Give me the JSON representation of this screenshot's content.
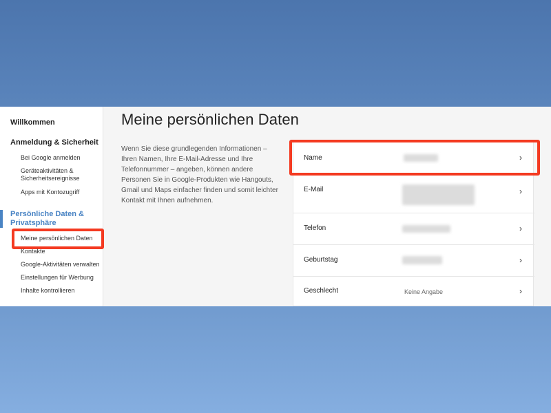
{
  "sidebar": {
    "welcome": "Willkommen",
    "security_section": "Anmeldung & Sicherheit",
    "security_items": [
      "Bei Google anmelden",
      "Geräteaktivitäten & Sicherheitsereignisse",
      "Apps mit Kontozugriff"
    ],
    "personal_section": "Persönliche Daten & Privatsphäre",
    "personal_items": [
      "Meine persönlichen Daten",
      "Kontakte",
      "Google-Aktivitäten verwalten",
      "Einstellungen für Werbung",
      "Inhalte kontrollieren"
    ]
  },
  "main": {
    "title": "Meine persönlichen Daten",
    "description": "Wenn Sie diese grundlegenden Informationen – Ihren Namen, Ihre E-Mail-Adresse und Ihre Telefonnummer – angeben, können andere Personen Sie in Google-Produkten wie Hangouts, Gmail und Maps einfacher finden und somit leichter Kontakt mit Ihnen aufnehmen."
  },
  "fields": [
    {
      "label": "Name",
      "value": ""
    },
    {
      "label": "E-Mail",
      "value": ""
    },
    {
      "label": "Telefon",
      "value": ""
    },
    {
      "label": "Geburtstag",
      "value": ""
    },
    {
      "label": "Geschlecht",
      "value": "Keine Angabe"
    }
  ],
  "icons": {
    "row_chevron": "chevron-right-icon"
  },
  "colors": {
    "highlight": "#f43a21",
    "accent": "#4a84c4"
  }
}
